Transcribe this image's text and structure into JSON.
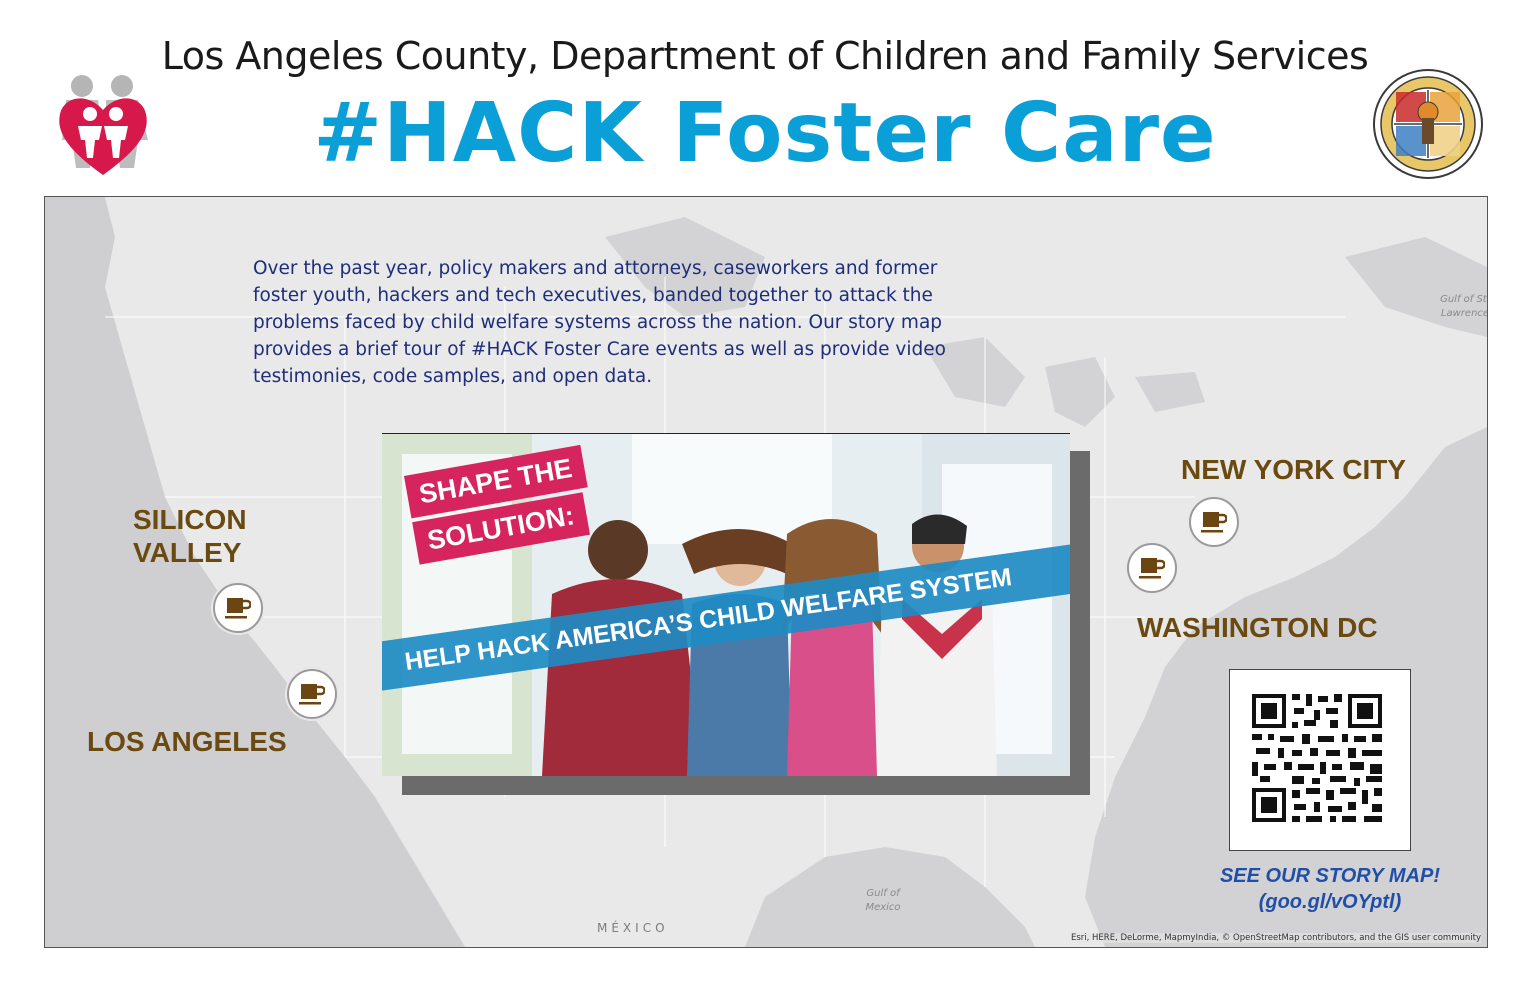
{
  "header": {
    "organization": "Los Angeles County, Department of Children and Family Services",
    "title": "#HACK Foster Care"
  },
  "logos": {
    "left": "dcfs-family-heart-logo",
    "right": "county-of-los-angeles-seal",
    "seal_text": "COUNTY OF LOS ANGELES · CALIFORNIA"
  },
  "map": {
    "intro": "Over the past year, policy makers and attorneys, caseworkers and former foster youth, hackers and tech executives, banded together to attack the problems faced by child welfare systems across the nation. Our story map provides a brief tour of #HACK Foster Care events as well as provide video testimonies, code samples, and open data.",
    "labels": {
      "mexico": "MÉXICO",
      "gulf_mexico": "Gulf of Mexico",
      "gulf_stlawrence": "Gulf of St. Lawrence"
    },
    "attribution": "Esri, HERE, DeLorme, MapmyIndia, © OpenStreetMap contributors, and the GIS user community",
    "cities": [
      {
        "name": "SILICON VALLEY",
        "line1": "SILICON",
        "line2": "VALLEY",
        "icon": "coffee-cup-icon"
      },
      {
        "name": "LOS ANGELES",
        "icon": "coffee-cup-icon"
      },
      {
        "name": "NEW YORK CITY",
        "icon": "coffee-cup-icon"
      },
      {
        "name": "WASHINGTON DC",
        "icon": "coffee-cup-icon"
      }
    ]
  },
  "promo": {
    "banner_line1": "SHAPE THE",
    "banner_line2": "SOLUTION:",
    "ribbon": "HELP HACK AMERICA’S CHILD WELFARE SYSTEM"
  },
  "story": {
    "cta": "SEE OUR STORY MAP!",
    "link": "(goo.gl/vOYptl)"
  },
  "colors": {
    "title": "#0b9fd8",
    "city": "#6b4a12",
    "intro": "#1f2e7a",
    "story": "#1f4fa8",
    "banner": "#d6245e",
    "ribbon": "#1e8bc3"
  }
}
